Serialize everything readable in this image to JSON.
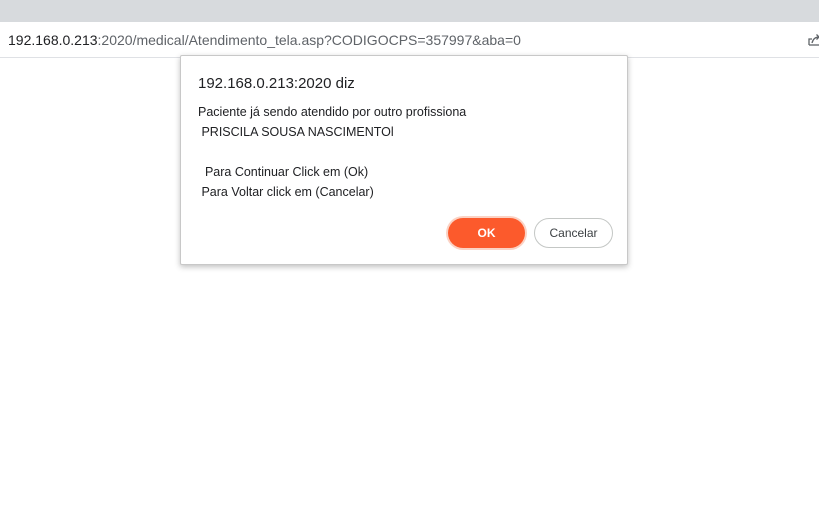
{
  "browser": {
    "url_host": "192.168.0.213",
    "url_rest": ":2020/medical/Atendimento_tela.asp?CODIGOCPS=357997&aba=0"
  },
  "dialog": {
    "title": "192.168.0.213:2020 diz",
    "lines": [
      "Paciente já sendo atendido por outro profissiona",
      " PRISCILA SOUSA NASCIMENTOl",
      "  Para Continuar Click em (Ok)",
      " Para Voltar click em (Cancelar)"
    ],
    "ok_label": "OK",
    "cancel_label": "Cancelar"
  },
  "colors": {
    "ok_button": "#fc5a2c"
  },
  "icons": {
    "share": "share-icon"
  }
}
